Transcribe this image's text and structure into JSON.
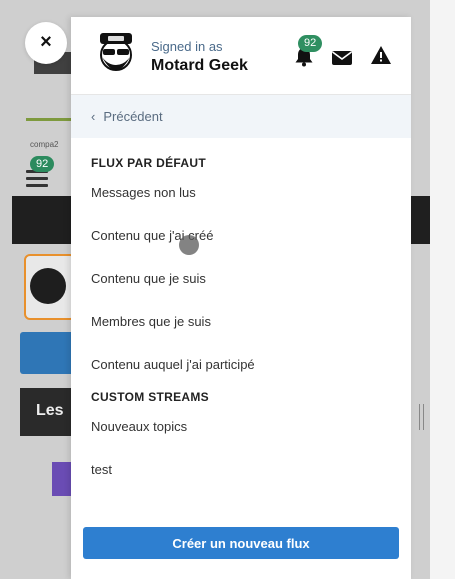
{
  "background": {
    "compa_text": "compa2",
    "menu_badge": "92",
    "les_text": "Les"
  },
  "close": {
    "label": "×"
  },
  "user": {
    "signed_in_label": "Signed in as",
    "name": "Motard Geek",
    "notification_count": "92"
  },
  "icons": {
    "notifications": "bell-icon",
    "messages": "envelope-icon",
    "reports": "warning-icon",
    "back": "chevron-left-icon"
  },
  "nav": {
    "back_label": "Précédent"
  },
  "default_streams": {
    "title": "FLUX PAR DÉFAUT",
    "items": [
      "Messages non lus",
      "Contenu que j'ai créé",
      "Contenu que je suis",
      "Membres que je suis",
      "Contenu auquel j'ai participé"
    ]
  },
  "custom_streams": {
    "title": "CUSTOM STREAMS",
    "items": [
      "Nouveaux topics",
      "test"
    ]
  },
  "create_button": {
    "label": "Créer un nouveau flux"
  },
  "colors": {
    "accent": "#2e7fd0",
    "badge": "#2f8f61",
    "back_row_bg": "#f1f5f9"
  }
}
